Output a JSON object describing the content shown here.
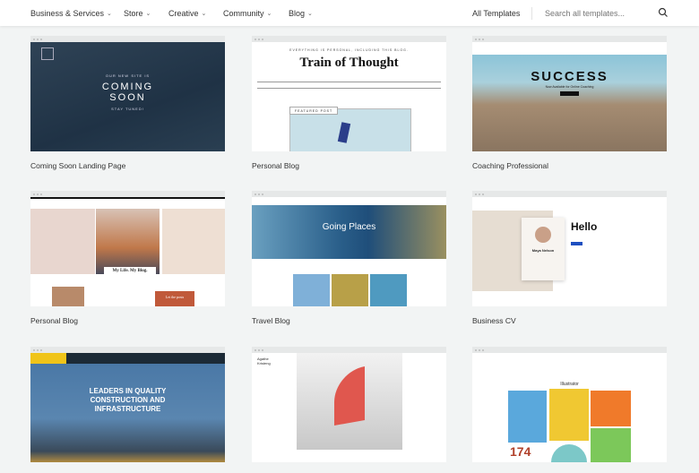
{
  "header": {
    "nav": [
      {
        "label": "Business & Services"
      },
      {
        "label": "Store"
      },
      {
        "label": "Creative"
      },
      {
        "label": "Community"
      },
      {
        "label": "Blog"
      }
    ],
    "all_templates": "All Templates",
    "search_placeholder": "Search all templates...",
    "search_icon": "search-icon"
  },
  "templates": [
    {
      "name": "Coming Soon Landing Page",
      "thumb": {
        "line1": "OUR NEW SITE IS",
        "title": "COMING SOON",
        "line2": "STAY TUNED!"
      }
    },
    {
      "name": "Personal Blog",
      "thumb": {
        "tagline": "EVERYTHING IS PERSONAL, INCLUDING THIS BLOG.",
        "title": "Train of Thought",
        "featured": "FEATURED POST"
      }
    },
    {
      "name": "Coaching Professional",
      "thumb": {
        "title": "SUCCESS",
        "subtitle": "Now Available for Online Coaching"
      }
    },
    {
      "name": "Personal Blog",
      "thumb": {
        "title": "My Life. My Blog.",
        "cta": "Let the posts"
      }
    },
    {
      "name": "Travel Blog",
      "thumb": {
        "title": "Going Places"
      }
    },
    {
      "name": "Business CV",
      "thumb": {
        "title": "Hello",
        "person": "Maya Nelson"
      }
    },
    {
      "name": "",
      "thumb": {
        "title": "LEADERS IN QUALITY CONSTRUCTION AND INFRASTRUCTURE"
      }
    },
    {
      "name": "",
      "thumb": {
        "title": "Agathe Kristeng"
      }
    },
    {
      "name": "",
      "thumb": {
        "title": "Illustrator",
        "number": "174"
      }
    }
  ]
}
